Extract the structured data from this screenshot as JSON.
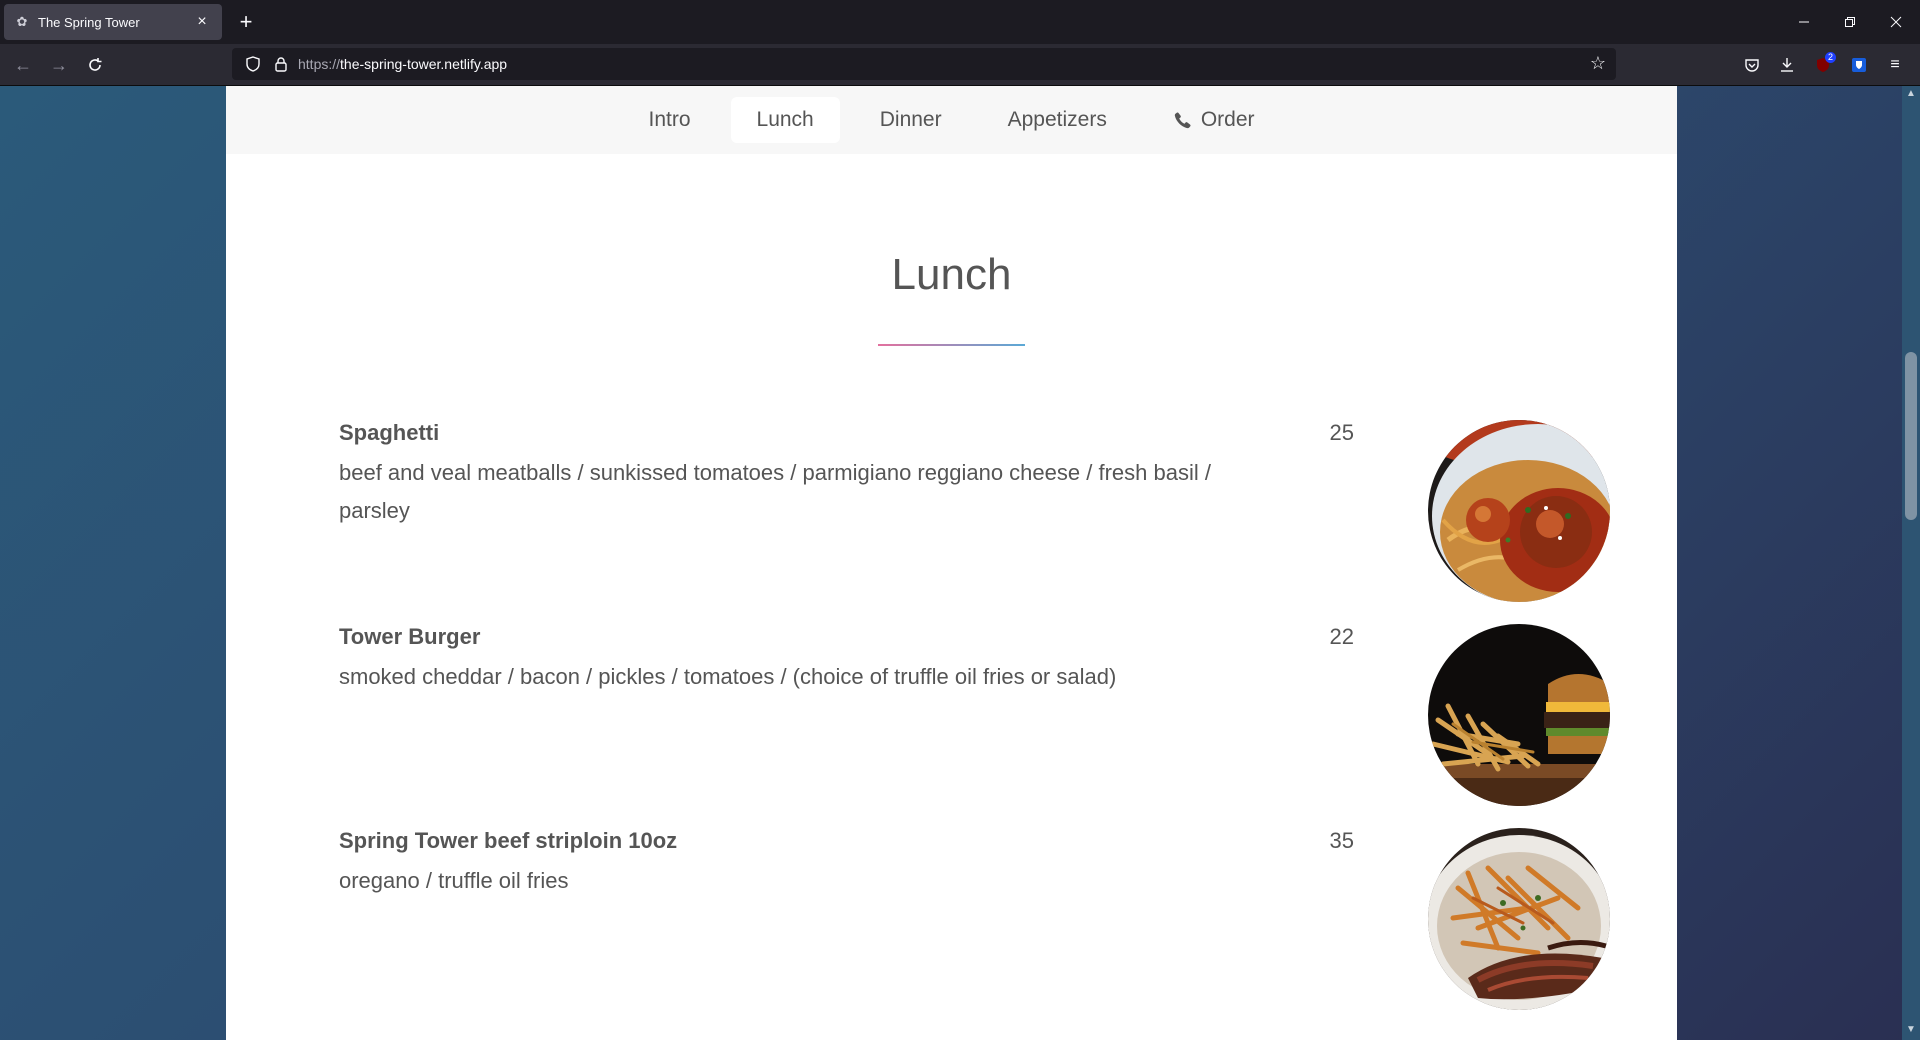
{
  "browser": {
    "tab_title": "The Spring Tower",
    "url_scheme": "https://",
    "url_host": "the-spring-tower.netlify.app",
    "extension_badge": "2"
  },
  "nav": {
    "items": [
      {
        "label": "Intro"
      },
      {
        "label": "Lunch"
      },
      {
        "label": "Dinner"
      },
      {
        "label": "Appetizers"
      },
      {
        "label": "Order",
        "icon": "phone-icon"
      }
    ],
    "active": "Lunch"
  },
  "section": {
    "title": "Lunch"
  },
  "dishes": [
    {
      "name": "Spaghetti",
      "price": "25",
      "description": "beef and veal meatballs / sunkissed tomatoes / parmigiano reggiano cheese / fresh basil / parsley",
      "photo": "spaghetti-photo"
    },
    {
      "name": "Tower Burger",
      "price": "22",
      "description": "smoked cheddar / bacon / pickles / tomatoes / (choice of truffle oil fries or salad)",
      "photo": "burger-photo"
    },
    {
      "name": "Spring Tower beef striploin 10oz",
      "price": "35",
      "description": "oregano / truffle oil fries",
      "photo": "steak-photo"
    }
  ],
  "colors": {
    "page_bg": "#2b5a7a",
    "text": "#555555",
    "nav_bg": "#f7f7f7",
    "divider_start": "#e3709e",
    "divider_end": "#5aa9d6"
  }
}
